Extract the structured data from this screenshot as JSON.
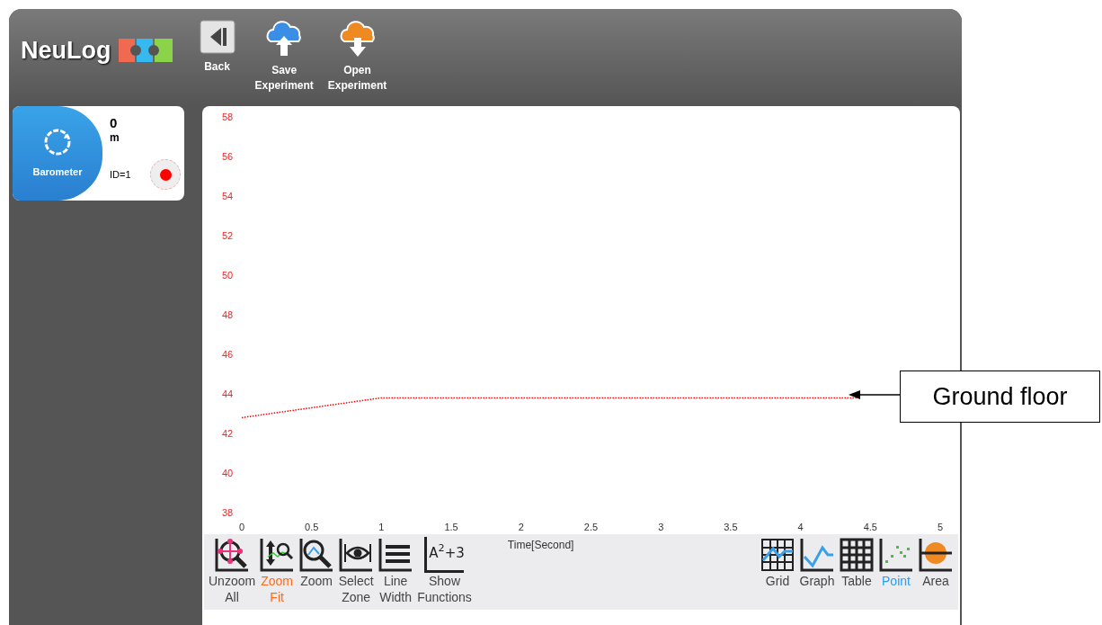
{
  "header": {
    "logo": "NeuLog",
    "buttons": [
      {
        "kind": "back",
        "label": "Back"
      },
      {
        "kind": "save",
        "label": "Save\nExperiment"
      },
      {
        "kind": "open",
        "label": "Open\nExperiment"
      }
    ]
  },
  "sensor": {
    "name": "Barometer",
    "value": "0",
    "unit": "m",
    "id": "ID=1"
  },
  "chart": {
    "chart_data": {
      "type": "line",
      "xlabel": "Time[Second]",
      "x": [
        0,
        0.25,
        0.5,
        0.75,
        1,
        1.5,
        2,
        2.5,
        3,
        3.5,
        4,
        4.4
      ],
      "series": [
        {
          "color": "#ff0000",
          "line_style": "dotted",
          "values": [
            42.8,
            43.05,
            43.3,
            43.55,
            43.8,
            43.8,
            43.8,
            43.8,
            43.8,
            43.8,
            43.8,
            43.8
          ]
        }
      ],
      "xlim": [
        0,
        5
      ],
      "ylim": [
        38,
        58
      ],
      "xticks": [
        0,
        0.5,
        1,
        1.5,
        2,
        2.5,
        3,
        3.5,
        4,
        4.5,
        5
      ],
      "yticks": [
        38,
        40,
        42,
        44,
        46,
        48,
        50,
        52,
        54,
        56,
        58
      ]
    }
  },
  "tools": [
    {
      "kind": "unzoom",
      "label": "Unzoom\nAll",
      "selected": false
    },
    {
      "kind": "zoom-fit",
      "label": "Zoom\nFit",
      "selected": true
    },
    {
      "kind": "zoom",
      "label": "Zoom",
      "selected": false
    },
    {
      "kind": "select-zone",
      "label": "Select\nZone",
      "selected": false
    },
    {
      "kind": "line-width",
      "label": "Line\nWidth",
      "selected": false
    },
    {
      "kind": "functions",
      "label": "Show\nFunctions",
      "glyph": "A$^{2}$+3",
      "selected": false
    }
  ],
  "views": [
    {
      "kind": "grid",
      "label": "Grid",
      "selected": false
    },
    {
      "kind": "graph",
      "label": "Graph",
      "selected": false
    },
    {
      "kind": "table",
      "label": "Table",
      "selected": false
    },
    {
      "kind": "point",
      "label": "Point",
      "selected": true
    },
    {
      "kind": "area",
      "label": "Area",
      "selected": false
    }
  ],
  "callout": {
    "text": "Ground floor"
  }
}
